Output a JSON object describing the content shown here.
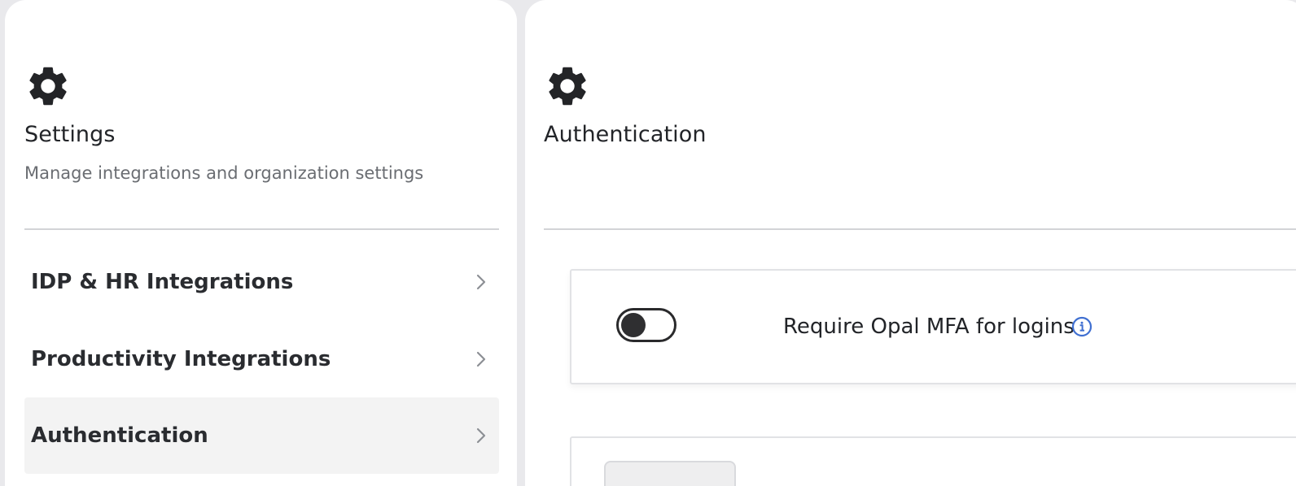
{
  "sidebar": {
    "icon": "gear-icon",
    "title": "Settings",
    "subtitle": "Manage integrations and organization settings",
    "items": [
      {
        "label": "IDP & HR Integrations",
        "active": false
      },
      {
        "label": "Productivity Integrations",
        "active": false
      },
      {
        "label": "Authentication",
        "active": true
      }
    ]
  },
  "main": {
    "icon": "gear-icon",
    "title": "Authentication",
    "settings": [
      {
        "label": "Require Opal MFA for logins",
        "enabled": false,
        "info_icon": "info-icon"
      }
    ]
  },
  "colors": {
    "background": "#e9e9ec",
    "panel": "#ffffff",
    "active_item": "#f3f3f3",
    "info_accent": "#3f6fd1",
    "text": "#222428",
    "muted_text": "#6a6d72"
  }
}
